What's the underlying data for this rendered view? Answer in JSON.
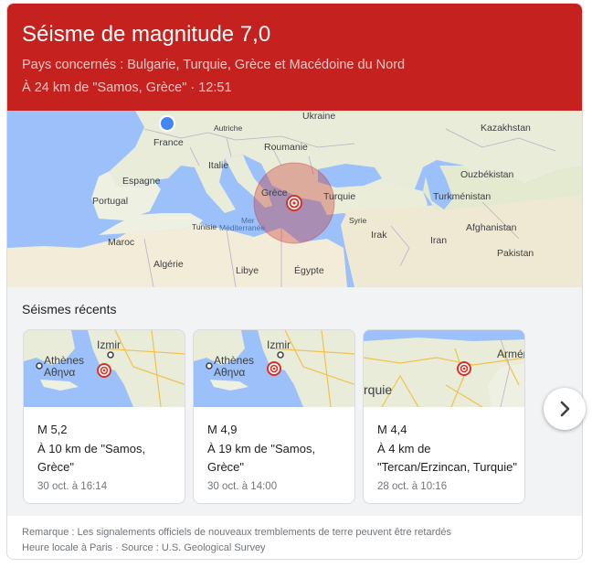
{
  "header": {
    "title": "Séisme de magnitude 7,0",
    "countries": "Pays concernés : Bulgarie, Turquie, Grèce et Macédoine du Nord",
    "location_time": "À 24 km de \"Samos, Grèce\" · 12:51",
    "background_color": "#c5221f"
  },
  "map": {
    "labels": {
      "ukraine": "Ukraine",
      "kazakhstan": "Kazakhstan",
      "autriche": "Autriche",
      "france": "France",
      "roumanie": "Roumanie",
      "italie": "Italie",
      "ouzbekistan": "Ouzbékistan",
      "espagne": "Espagne",
      "grece": "Grèce",
      "turquie": "Turquie",
      "turkmenistan": "Turkménistan",
      "portugal": "Portugal",
      "tunisie": "Tunisie",
      "syrie": "Syrie",
      "mer1": "Mer",
      "mer2": "Méditerranée",
      "afghanistan": "Afghanistan",
      "maroc": "Maroc",
      "irak": "Irak",
      "iran": "Iran",
      "pakistan": "Pakistan",
      "algerie": "Algérie",
      "libye": "Libye",
      "egypte": "Égypte"
    },
    "icons": [
      "epicenter-marker-icon",
      "user-location-dot-icon"
    ]
  },
  "recent": {
    "title": "Séismes récents",
    "cards": [
      {
        "magnitude": "M 5,2",
        "location": "À 10 km de \"Samos, Grèce\"",
        "time": "30 oct. à 16:14",
        "map_labels": [
          "Izmir",
          "Athènes",
          "Αθηνα"
        ]
      },
      {
        "magnitude": "M 4,9",
        "location": "À 19 km de \"Samos, Grèce\"",
        "time": "30 oct. à 14:00",
        "map_labels": [
          "Izmir",
          "Athènes",
          "Αθηνα"
        ]
      },
      {
        "magnitude": "M 4,4",
        "location": "À 4 km de \"Tercan/Erzincan, Turquie\"",
        "time": "28 oct. à 10:16",
        "map_labels": [
          "rquie",
          "Arméni"
        ]
      }
    ],
    "next_icon": "chevron-right-icon"
  },
  "footer": {
    "note": "Remarque : Les signalements officiels de nouveaux tremblements de terre peuvent être retardés",
    "source": "Heure locale à Paris · Source : U.S. Geological Survey"
  }
}
